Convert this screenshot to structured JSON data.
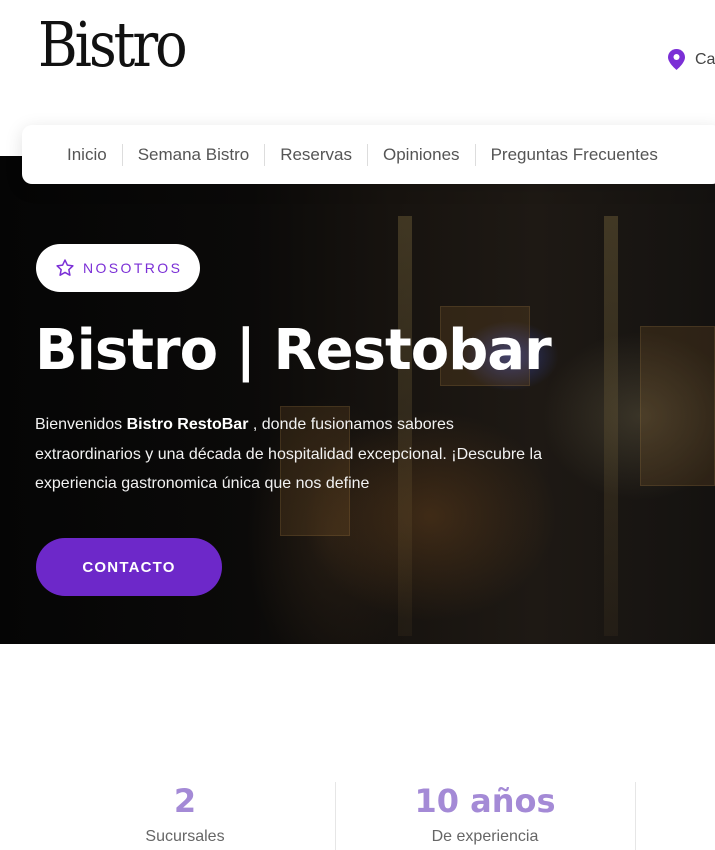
{
  "brand": {
    "logo_text": "Bistro"
  },
  "header": {
    "location_text": "Ca"
  },
  "nav": {
    "items": [
      {
        "label": "Inicio"
      },
      {
        "label": "Semana Bistro"
      },
      {
        "label": "Reservas"
      },
      {
        "label": "Opiniones"
      },
      {
        "label": "Preguntas Frecuentes"
      }
    ]
  },
  "hero": {
    "badge": "NOSOTROS",
    "title": "Bistro | Restobar",
    "desc_prefix": "Bienvenidos ",
    "desc_bold": "Bistro RestoBar",
    "desc_rest": " , donde fusionamos sabores extraordinarios y una década de hospitalidad excepcional. ¡Descubre la experiencia gastronomica única que nos define",
    "cta_label": "CONTACTO"
  },
  "stats": [
    {
      "value": "2",
      "label": "Sucursales"
    },
    {
      "value": "10 años",
      "label": "De experiencia"
    }
  ],
  "colors": {
    "accent": "#6d28c9",
    "badge_text": "#7b2fd6",
    "stat_value": "#a48ad6"
  },
  "icons": {
    "location": "map-pin-icon",
    "badge": "star-icon"
  }
}
